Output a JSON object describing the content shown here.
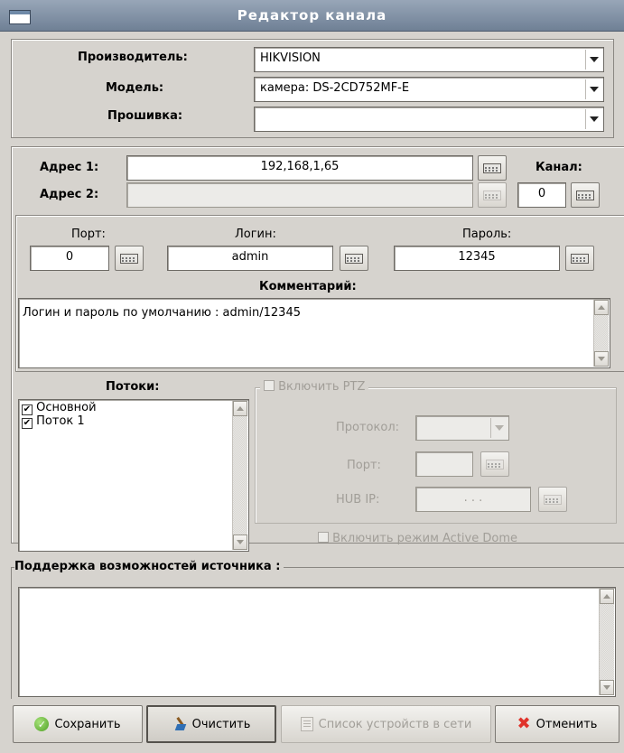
{
  "window": {
    "title": "Редактор канала"
  },
  "device": {
    "manufacturer_label": "Производитель:",
    "manufacturer_value": "HIKVISION",
    "model_label": "Модель:",
    "model_value": "камера: DS-2CD752MF-E",
    "firmware_label": "Прошивка:",
    "firmware_value": ""
  },
  "address": {
    "address1_label": "Адрес 1:",
    "address1_value": "192,168,1,65",
    "address2_label": "Адрес 2:",
    "address2_value": "",
    "channel_label": "Канал:",
    "channel_value": "0"
  },
  "auth": {
    "port_label": "Порт:",
    "port_value": "0",
    "login_label": "Логин:",
    "login_value": "admin",
    "password_label": "Пароль:",
    "password_value": "12345",
    "comment_label": "Комментарий:",
    "comment_value": "Логин и пароль по умолчанию : admin/12345"
  },
  "streams": {
    "label": "Потоки:",
    "items": [
      {
        "label": "Основной",
        "checked": true
      },
      {
        "label": "Поток 1",
        "checked": true
      }
    ]
  },
  "ptz": {
    "enable_label": "Включить PTZ",
    "enabled": false,
    "protocol_label": "Протокол:",
    "protocol_value": "",
    "port_label": "Порт:",
    "port_value": "",
    "hub_ip_label": "HUB IP:",
    "hub_ip_value": ". . .",
    "active_dome_label": "Включить режим Active Dome",
    "active_dome_enabled": false
  },
  "capabilities": {
    "label": "Поддержка возможностей источника :",
    "value": ""
  },
  "buttons": {
    "save": "Сохранить",
    "clear": "Очистить",
    "device_list": "Список устройств в сети",
    "cancel": "Отменить"
  },
  "icons": {
    "save": "check-circle-icon",
    "clear": "broom-icon",
    "device_list": "document-list-icon",
    "cancel": "red-x-icon",
    "keyboard": "keyboard-icon"
  },
  "colors": {
    "titlebar": "#7f8fa3",
    "background": "#d6d3ce",
    "cancel_icon": "#e0332b",
    "save_icon": "#4fa125"
  }
}
